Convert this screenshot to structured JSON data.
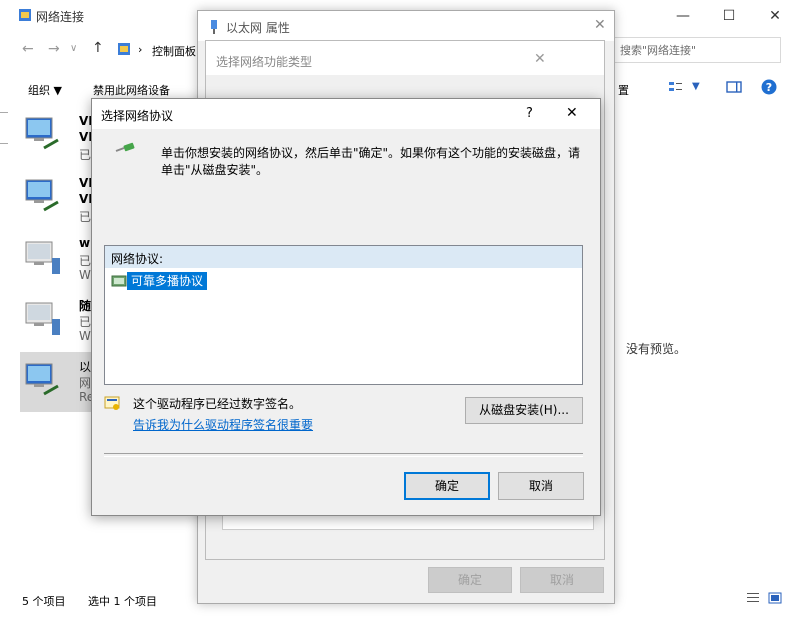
{
  "explorer": {
    "title": "网络连接",
    "breadcrumb_sep": "›",
    "breadcrumb_root": "控制面板",
    "search_placeholder": "搜索\"网络连接\"",
    "toolbar": {
      "organize": "组织 ▼",
      "disable_device": "禁用此网络设备",
      "settings_fragment": "置"
    },
    "connections": [
      {
        "line1": "VN",
        "line2": "VN",
        "line3": "已"
      },
      {
        "line1": "VN",
        "line2": "VN",
        "line3": "已"
      },
      {
        "line1": "wi",
        "line2": "已",
        "line3": "Wi"
      },
      {
        "line1": "随",
        "line2": "已",
        "line3": "Wi"
      },
      {
        "line1": "以",
        "line2": "网",
        "line3": "Re"
      }
    ],
    "preview_text": "没有预览。",
    "status": {
      "count": "5 个项目",
      "selected": "选中 1 个项目"
    }
  },
  "props_dialog": {
    "title": "以太网 属性",
    "ok": "确定",
    "cancel": "取消"
  },
  "feature_dialog": {
    "title": "选择网络功能类型"
  },
  "protocol_dialog": {
    "title": "选择网络协议",
    "help": "?",
    "close": "✕",
    "instruction": "单击你想安装的网络协议，然后单击\"确定\"。如果你有这个功能的安装磁盘，请单击\"从磁盘安装\"。",
    "list_header": "网络协议:",
    "items": [
      {
        "label": "可靠多播协议"
      }
    ],
    "signed_text": "这个驱动程序已经过数字签名。",
    "signing_link": "告诉我为什么驱动程序签名很重要",
    "have_disk": "从磁盘安装(H)...",
    "ok": "确定",
    "cancel": "取消"
  }
}
